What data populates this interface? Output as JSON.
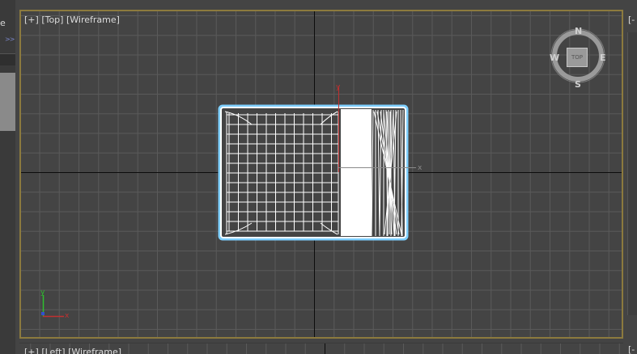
{
  "left_panel": {
    "label_fragment": "e",
    "chevrons": ">>"
  },
  "viewport_top": {
    "plus": "[+]",
    "view": "[Top]",
    "shading": "[Wireframe]"
  },
  "viewport_left": {
    "plus": "[+]",
    "view": "[Left]",
    "shading": "[Wireframe]"
  },
  "right_viewport": {
    "label_fragment": "[-"
  },
  "bottom_right_viewport": {
    "label_fragment": "[-"
  },
  "viewcube": {
    "north": "N",
    "south": "S",
    "east": "E",
    "west": "W",
    "face": "TOP"
  },
  "gizmo": {
    "y_label": "y",
    "x_label": "x"
  },
  "axis_tripod": {
    "y_label": "y",
    "x_label": "x"
  },
  "colors": {
    "viewport_border": "#8c7a3e",
    "grid_line": "#5a5a5a",
    "world_axis": "#000000",
    "wireframe": "#ffffff",
    "selection_glow": "#7fd0ff",
    "gizmo_y": "#c03030",
    "tripod_y": "#2fbf2f",
    "tripod_x": "#c03030",
    "tripod_z": "#3050d0"
  }
}
